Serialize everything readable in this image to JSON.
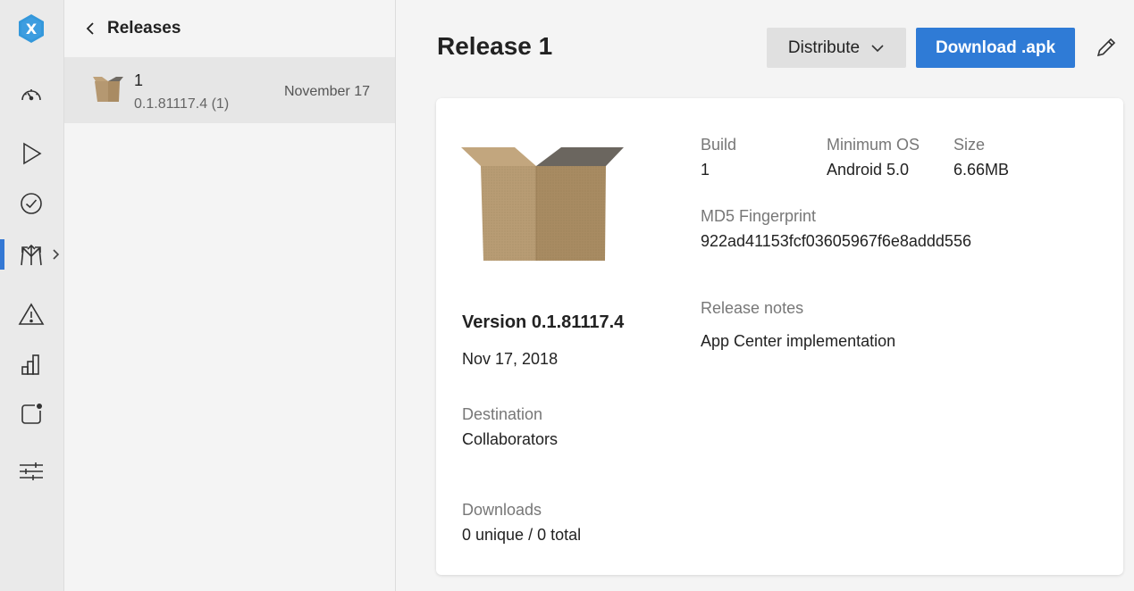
{
  "rail": {
    "items": [
      "overview",
      "build",
      "test",
      "distribute",
      "diagnostics",
      "analytics",
      "push",
      "settings"
    ],
    "accent": "#3478d4"
  },
  "list": {
    "back_label": "Releases",
    "releases": [
      {
        "name": "1",
        "version": "0.1.81117.4 (1)",
        "date": "November 17"
      }
    ]
  },
  "main": {
    "title": "Release 1",
    "distribute_label": "Distribute",
    "download_label": "Download .apk",
    "download_color": "#2f7bd6"
  },
  "details": {
    "build_label": "Build",
    "build_value": "1",
    "min_os_label": "Minimum OS",
    "min_os_value": "Android 5.0",
    "size_label": "Size",
    "size_value": "6.66MB",
    "md5_label": "MD5 Fingerprint",
    "md5_value": "922ad41153fcf03605967f6e8addd556",
    "version_title": "Version 0.1.81117.4",
    "version_date": "Nov 17, 2018",
    "release_notes_label": "Release notes",
    "release_notes_value": "App Center implementation",
    "destination_label": "Destination",
    "destination_value": "Collaborators",
    "downloads_label": "Downloads",
    "downloads_value": "0 unique / 0 total"
  }
}
